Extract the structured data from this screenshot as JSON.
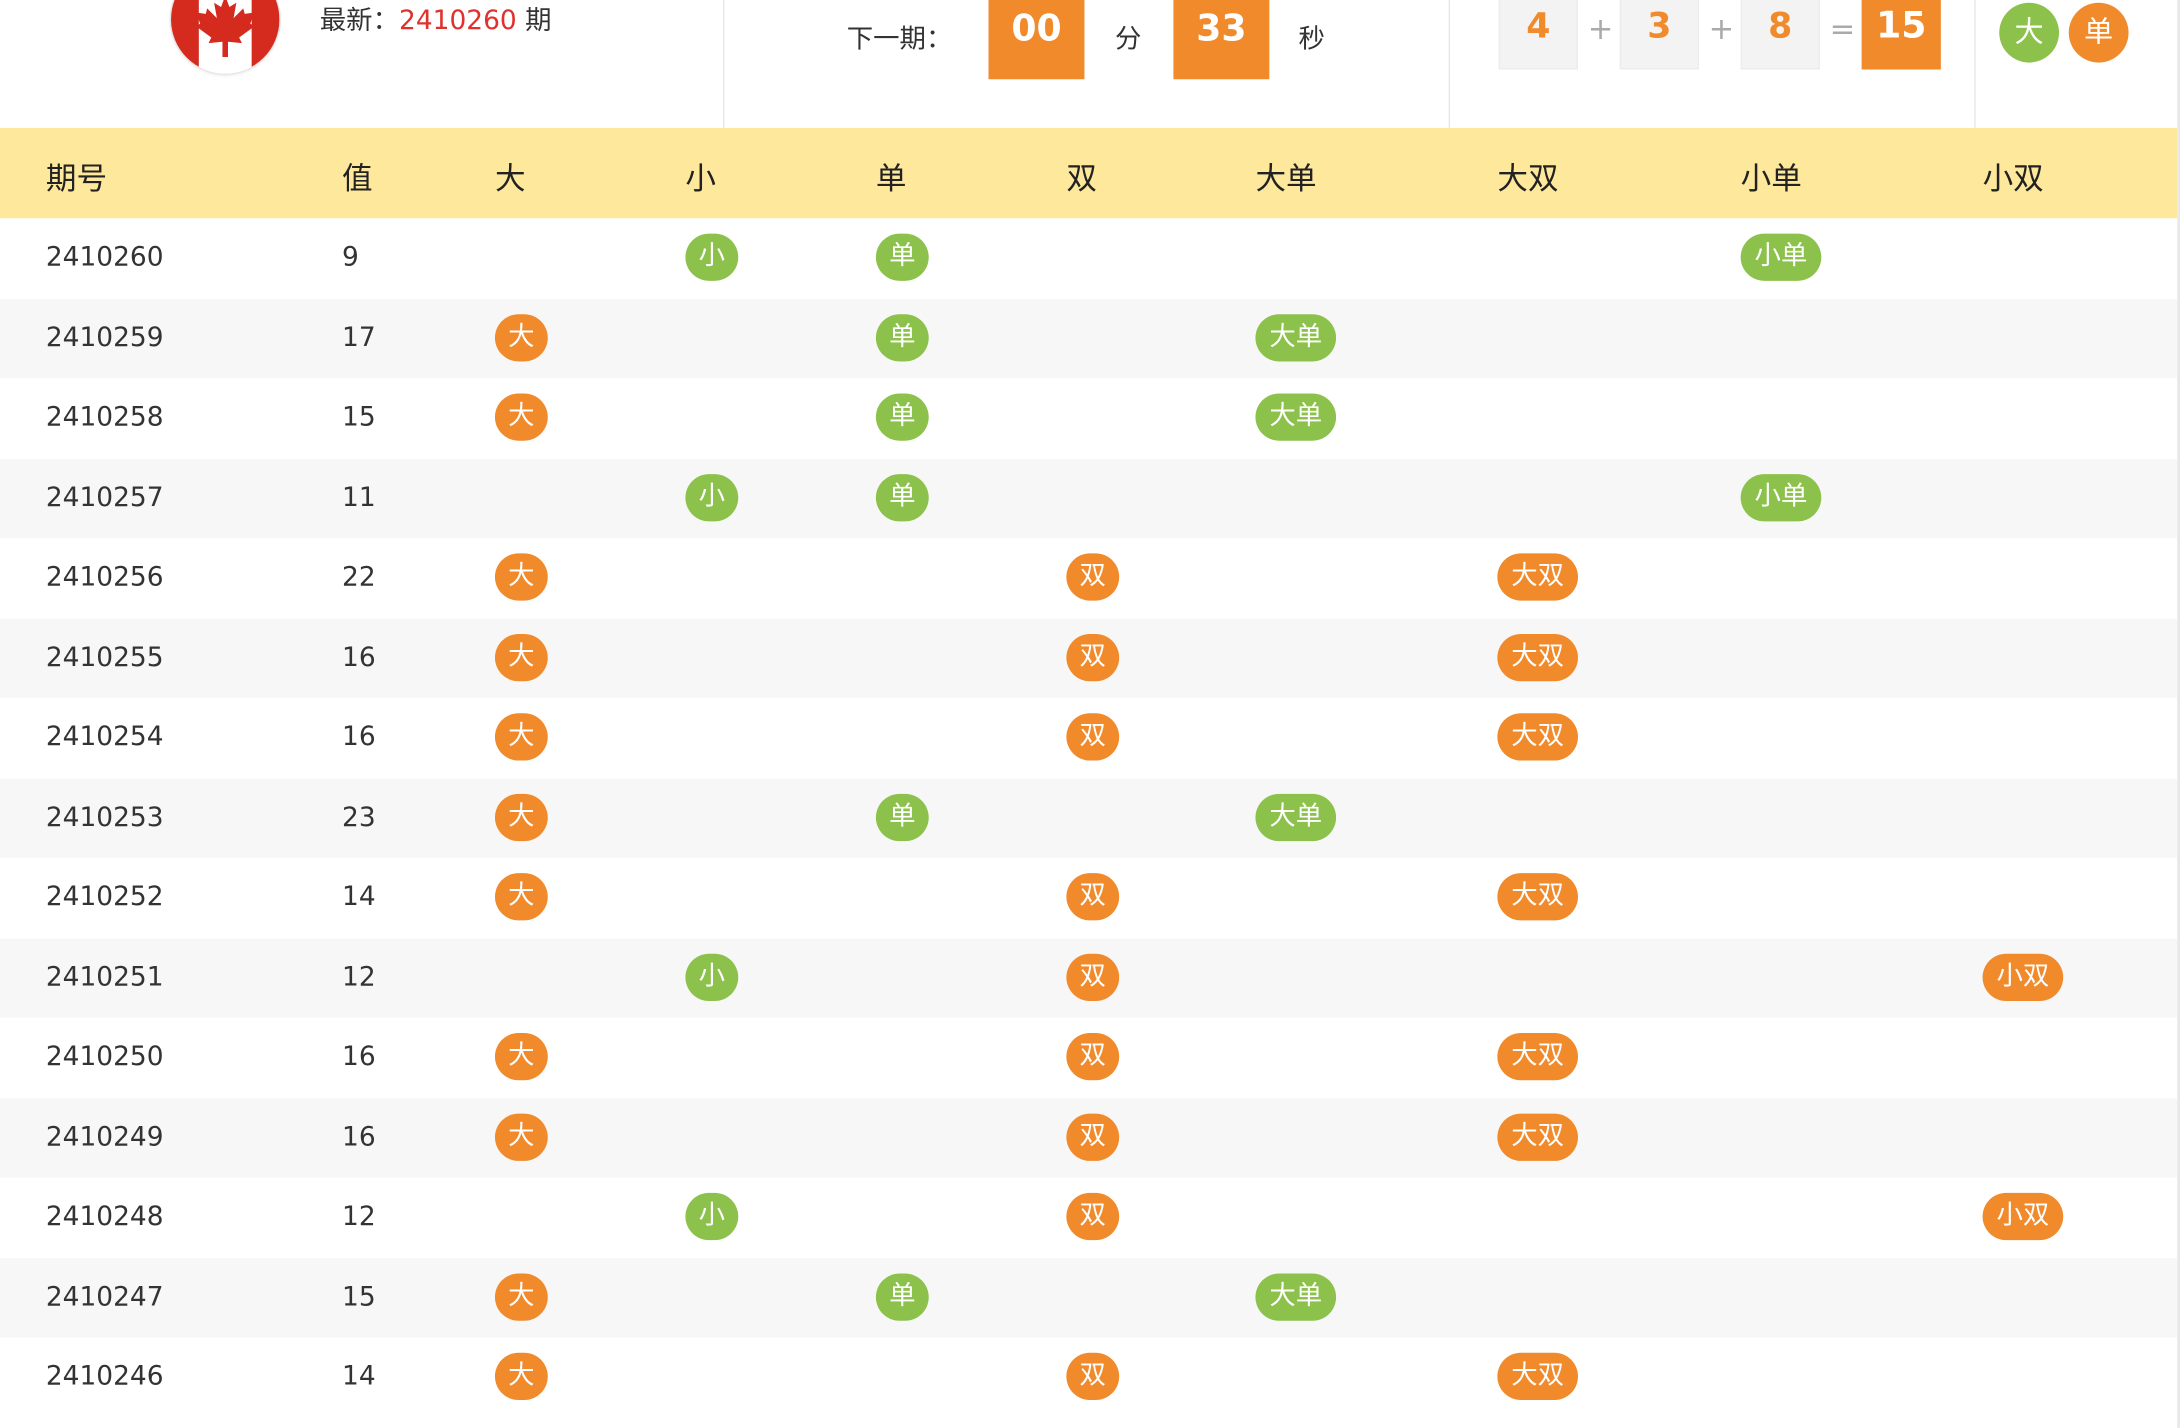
{
  "header": {
    "latest_label": "最新：",
    "latest_issue": "2410260",
    "latest_suffix": " 期",
    "next_label": "下一期：",
    "minutes": "00",
    "minutes_unit": "分",
    "seconds": "33",
    "seconds_unit": "秒",
    "balls": [
      "4",
      "3",
      "8"
    ],
    "plus": "+",
    "equals": "=",
    "sum": "15",
    "result_size": "大",
    "result_parity": "单",
    "colors": {
      "accent_orange": "#f08a2b",
      "green": "#8cc14b",
      "issue_red": "#e0312c",
      "header_yellow": "#fde89c"
    }
  },
  "table": {
    "columns": [
      "期号",
      "值",
      "大",
      "小",
      "单",
      "双",
      "大单",
      "大双",
      "小单",
      "小双"
    ],
    "rows": [
      {
        "issue": "2410260",
        "value": "9"
      },
      {
        "issue": "2410259",
        "value": "17"
      },
      {
        "issue": "2410258",
        "value": "15"
      },
      {
        "issue": "2410257",
        "value": "11"
      },
      {
        "issue": "2410256",
        "value": "22"
      },
      {
        "issue": "2410255",
        "value": "16"
      },
      {
        "issue": "2410254",
        "value": "16"
      },
      {
        "issue": "2410253",
        "value": "23"
      },
      {
        "issue": "2410252",
        "value": "14"
      },
      {
        "issue": "2410251",
        "value": "12"
      },
      {
        "issue": "2410250",
        "value": "16"
      },
      {
        "issue": "2410249",
        "value": "16"
      },
      {
        "issue": "2410248",
        "value": "12"
      },
      {
        "issue": "2410247",
        "value": "15"
      },
      {
        "issue": "2410246",
        "value": "14"
      }
    ]
  }
}
